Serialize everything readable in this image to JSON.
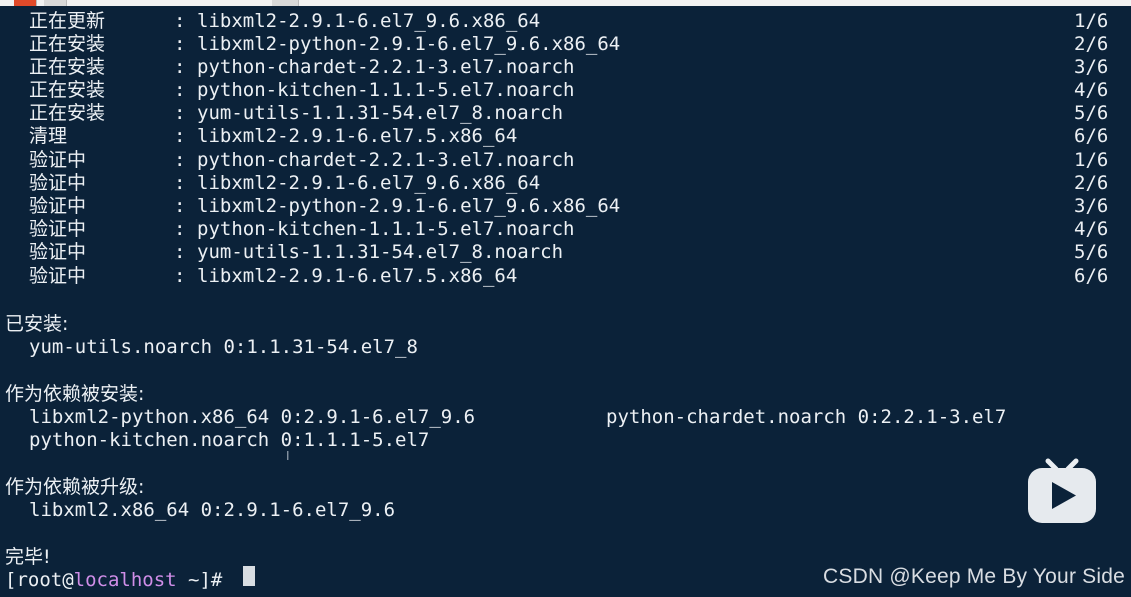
{
  "transaction": [
    {
      "op": "正在更新",
      "pkg": "libxml2-2.9.1-6.el7_9.6.x86_64",
      "count": "1/6"
    },
    {
      "op": "正在安装",
      "pkg": "libxml2-python-2.9.1-6.el7_9.6.x86_64",
      "count": "2/6"
    },
    {
      "op": "正在安装",
      "pkg": "python-chardet-2.2.1-3.el7.noarch",
      "count": "3/6"
    },
    {
      "op": "正在安装",
      "pkg": "python-kitchen-1.1.1-5.el7.noarch",
      "count": "4/6"
    },
    {
      "op": "正在安装",
      "pkg": "yum-utils-1.1.31-54.el7_8.noarch",
      "count": "5/6"
    },
    {
      "op": "清理",
      "pkg": "libxml2-2.9.1-6.el7.5.x86_64",
      "count": "6/6"
    },
    {
      "op": "验证中",
      "pkg": "python-chardet-2.2.1-3.el7.noarch",
      "count": "1/6"
    },
    {
      "op": "验证中",
      "pkg": "libxml2-2.9.1-6.el7_9.6.x86_64",
      "count": "2/6"
    },
    {
      "op": "验证中",
      "pkg": "libxml2-python-2.9.1-6.el7_9.6.x86_64",
      "count": "3/6"
    },
    {
      "op": "验证中",
      "pkg": "python-kitchen-1.1.1-5.el7.noarch",
      "count": "4/6"
    },
    {
      "op": "验证中",
      "pkg": "yum-utils-1.1.31-54.el7_8.noarch",
      "count": "5/6"
    },
    {
      "op": "验证中",
      "pkg": "libxml2-2.9.1-6.el7.5.x86_64",
      "count": "6/6"
    }
  ],
  "colon": ":",
  "installed": {
    "heading": "已安装:",
    "items": [
      "yum-utils.noarch 0:1.1.31-54.el7_8"
    ]
  },
  "dep_installed": {
    "heading": "作为依赖被安装:",
    "items": [
      "libxml2-python.x86_64 0:2.9.1-6.el7_9.6",
      "python-chardet.noarch 0:2.2.1-3.el7",
      "python-kitchen.noarch 0:1.1.1-5.el7"
    ]
  },
  "dep_updated": {
    "heading": "作为依赖被升级:",
    "items": [
      "libxml2.x86_64 0:2.9.1-6.el7_9.6"
    ]
  },
  "complete": "完毕!",
  "prompt": {
    "open": "[root@",
    "host": "localhost",
    "rest": " ~]#"
  },
  "watermark": "CSDN @Keep Me By Your Side",
  "logo_icon": "bilibili-tv-play-icon",
  "colors": {
    "background": "#0b2239",
    "text": "#ecf0f4",
    "hostname": "#d08ee8",
    "cursor": "#d8dde2"
  }
}
